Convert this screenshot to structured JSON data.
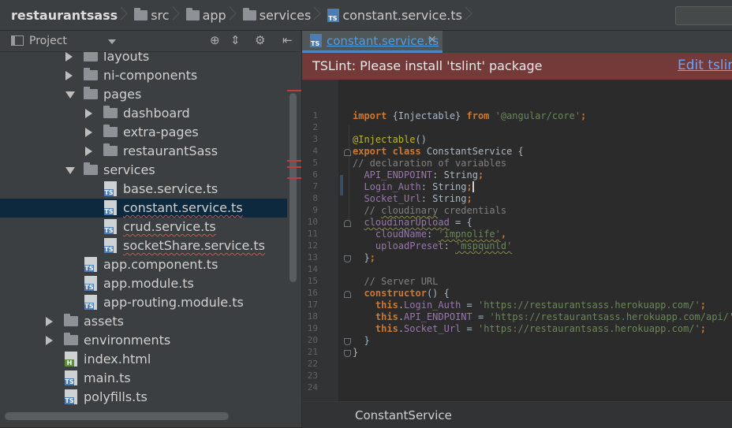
{
  "breadcrumb": [
    "restaurantsass",
    "src",
    "app",
    "services",
    "constant.service.ts"
  ],
  "project_panel": {
    "title": "Project",
    "icons": [
      "crosshair-icon",
      "collapse-icon",
      "gear-icon",
      "hide-icon"
    ]
  },
  "tree": [
    {
      "label": "layouts",
      "kind": "folder",
      "level": 2,
      "state": "collapsed"
    },
    {
      "label": "ni-components",
      "kind": "folder",
      "level": 2,
      "state": "collapsed"
    },
    {
      "label": "pages",
      "kind": "folder",
      "level": 2,
      "state": "expanded"
    },
    {
      "label": "dashboard",
      "kind": "folder",
      "level": 3,
      "state": "collapsed"
    },
    {
      "label": "extra-pages",
      "kind": "folder",
      "level": 3,
      "state": "collapsed"
    },
    {
      "label": "restaurantSass",
      "kind": "folder",
      "level": 3,
      "state": "collapsed"
    },
    {
      "label": "services",
      "kind": "folder",
      "level": 2,
      "state": "expanded"
    },
    {
      "label": "base.service.ts",
      "kind": "ts",
      "level": 3,
      "error": false
    },
    {
      "label": "constant.service.ts",
      "kind": "ts",
      "level": 3,
      "selected": true,
      "error": true
    },
    {
      "label": "crud.service.ts",
      "kind": "ts",
      "level": 3,
      "error": true
    },
    {
      "label": "socketShare.service.ts",
      "kind": "ts",
      "level": 3,
      "error": true
    },
    {
      "label": "app.component.ts",
      "kind": "ts",
      "level": 2
    },
    {
      "label": "app.module.ts",
      "kind": "ts",
      "level": 2
    },
    {
      "label": "app-routing.module.ts",
      "kind": "ts",
      "level": 2
    },
    {
      "label": "assets",
      "kind": "folder",
      "level": 1,
      "state": "collapsed"
    },
    {
      "label": "environments",
      "kind": "folder",
      "level": 1,
      "state": "collapsed"
    },
    {
      "label": "index.html",
      "kind": "html",
      "level": 1
    },
    {
      "label": "main.ts",
      "kind": "ts",
      "level": 1
    },
    {
      "label": "polyfills.ts",
      "kind": "ts",
      "level": 1
    }
  ],
  "editor": {
    "tab_label": "constant.service.ts",
    "lint_message": "TSLint: Please install 'tslint' package",
    "lint_action": "Edit tslint",
    "status_label": "ConstantService",
    "code": [
      [
        {
          "t": "import ",
          "c": "kw"
        },
        {
          "t": "{Injectable} "
        },
        {
          "t": "from ",
          "c": "kw"
        },
        {
          "t": "'@angular/core'",
          "c": "str"
        },
        {
          "t": ";",
          "c": "kw"
        }
      ],
      [],
      [
        {
          "t": "@Injectable",
          "c": "ann"
        },
        {
          "t": "()"
        }
      ],
      [
        {
          "t": "export class ",
          "c": "kw"
        },
        {
          "t": "ConstantService {"
        }
      ],
      [
        {
          "t": "// declaration of variables",
          "c": "cm"
        }
      ],
      [
        {
          "t": "  "
        },
        {
          "t": "API_ENDPOINT",
          "c": "fld"
        },
        {
          "t": ": String"
        },
        {
          "t": ";",
          "c": "kw"
        }
      ],
      [
        {
          "t": "  "
        },
        {
          "t": "Login_Auth",
          "c": "fld"
        },
        {
          "t": ": String"
        },
        {
          "t": ";",
          "c": "kw cur"
        }
      ],
      [
        {
          "t": "  "
        },
        {
          "t": "Socket_Url",
          "c": "fld"
        },
        {
          "t": ": String"
        },
        {
          "t": ";",
          "c": "kw"
        }
      ],
      [
        {
          "t": "  // ",
          "c": "cm"
        },
        {
          "t": "cloudinary",
          "c": "cm sq"
        },
        {
          "t": " credentials",
          "c": "cm"
        }
      ],
      [
        {
          "t": "  "
        },
        {
          "t": "cloudinarUpload",
          "c": "fld sq"
        },
        {
          "t": " = {"
        }
      ],
      [
        {
          "t": "    "
        },
        {
          "t": "cloudName",
          "c": "fld"
        },
        {
          "t": ": "
        },
        {
          "t": "'impnolife'",
          "c": "str sq"
        },
        {
          "t": ",",
          "c": "kw"
        }
      ],
      [
        {
          "t": "    "
        },
        {
          "t": "uploadPreset",
          "c": "fld"
        },
        {
          "t": ": "
        },
        {
          "t": "'mspqunld'",
          "c": "str sq"
        }
      ],
      [
        {
          "t": "  }"
        },
        {
          "t": ";",
          "c": "kw"
        }
      ],
      [],
      [
        {
          "t": "  // Server URL",
          "c": "cm"
        }
      ],
      [
        {
          "t": "  "
        },
        {
          "t": "constructor",
          "c": "kw"
        },
        {
          "t": "() {"
        }
      ],
      [
        {
          "t": "    "
        },
        {
          "t": "this",
          "c": "kw"
        },
        {
          "t": "."
        },
        {
          "t": "Login_Auth",
          "c": "fld"
        },
        {
          "t": " = "
        },
        {
          "t": "'https://restaurantsass.herokuapp.com/'",
          "c": "str"
        },
        {
          "t": ";",
          "c": "kw"
        }
      ],
      [
        {
          "t": "    "
        },
        {
          "t": "this",
          "c": "kw"
        },
        {
          "t": "."
        },
        {
          "t": "API_ENDPOINT",
          "c": "fld"
        },
        {
          "t": " = "
        },
        {
          "t": "'https://restaurantsass.herokuapp.com/api/'",
          "c": "str"
        },
        {
          "t": ";",
          "c": "kw"
        }
      ],
      [
        {
          "t": "    "
        },
        {
          "t": "this",
          "c": "kw"
        },
        {
          "t": "."
        },
        {
          "t": "Socket_Url",
          "c": "fld"
        },
        {
          "t": " = "
        },
        {
          "t": "'https://restaurantsass.herokuapp.com/'",
          "c": "str"
        },
        {
          "t": ";",
          "c": "kw"
        }
      ],
      [
        {
          "t": "  }"
        }
      ],
      [
        {
          "t": "}"
        }
      ],
      [],
      [],
      []
    ]
  }
}
